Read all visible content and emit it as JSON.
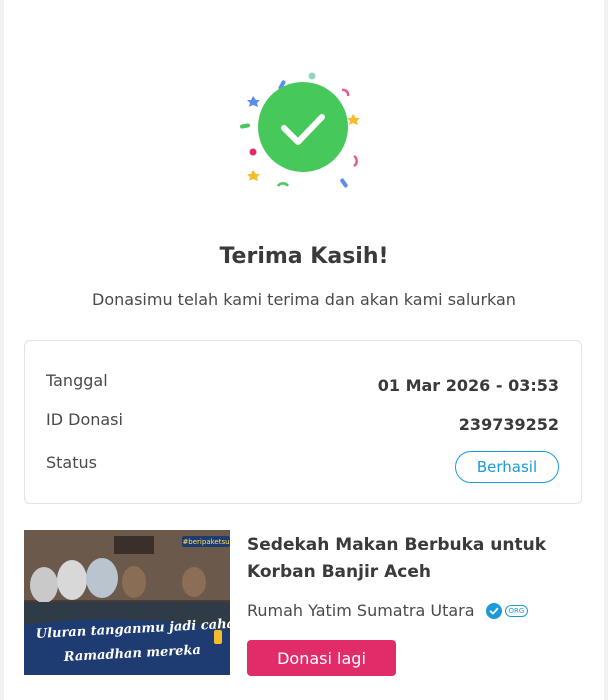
{
  "success": {
    "title": "Terima Kasih!",
    "message": "Donasimu telah kami terima dan akan kami salurkan"
  },
  "details": {
    "date_label": "Tanggal",
    "date_value": "01 Mar 2026 - 03:53",
    "id_label": "ID Donasi",
    "id_value": "239739252",
    "status_label": "Status",
    "status_value": "Berhasil"
  },
  "campaign": {
    "title": "Sedekah Makan Berbuka untuk Korban Banjir Aceh",
    "organizer": "Rumah Yatim Sumatra Utara",
    "org_badge": "ORG",
    "image_caption_line1": "Uluran tanganmu jadi cahaya",
    "image_caption_line2": "Ramadhan mereka",
    "image_hashtag": "#beripaketsu",
    "button_label": "Donasi lagi"
  },
  "colors": {
    "success_green": "#47c85a",
    "accent_blue": "#1a9bd7",
    "primary_pink": "#e02d6a"
  },
  "icons": [
    "check-icon",
    "confetti",
    "verified-icon"
  ]
}
